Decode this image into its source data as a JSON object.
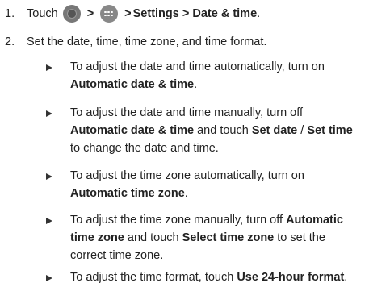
{
  "steps": [
    {
      "number": "1.",
      "verb": "Touch",
      "sep1": ">",
      "sep2": ">",
      "path": "Settings > Date & time",
      "end": "."
    },
    {
      "number": "2.",
      "text": "Set the date, time, time zone, and time format."
    }
  ],
  "icons": {
    "home": "home-button-icon",
    "apps": "all-apps-icon"
  },
  "bullets": [
    {
      "pre": "To adjust the date and time automatically, turn on ",
      "b1": "Automatic date & time",
      "post": "."
    },
    {
      "pre": "To adjust the date and time manually, turn off ",
      "b1": "Automatic date & time",
      "mid": " and touch ",
      "b2": "Set date",
      "slash": " / ",
      "b3": "Set time",
      "post": " to change the date and time."
    },
    {
      "pre": "To adjust the time zone automatically, turn on ",
      "b1": "Automatic time zone",
      "post": "."
    },
    {
      "pre": "To adjust the time zone manually, turn off ",
      "b1": "Automatic time zone",
      "mid": " and touch ",
      "b2": "Select time zone",
      "post": " to set the correct time zone."
    },
    {
      "pre": "To adjust the time format, touch ",
      "b1": "Use 24-hour format",
      "post": "."
    }
  ]
}
